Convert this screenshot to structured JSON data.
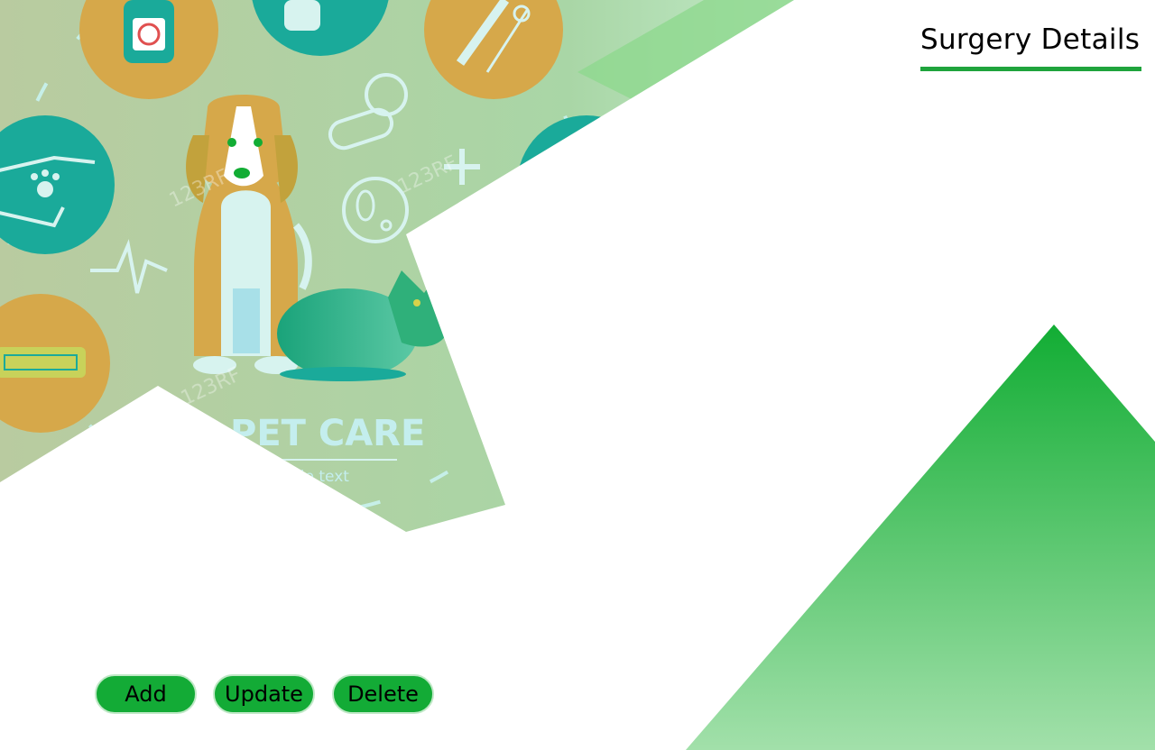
{
  "page": {
    "title": "Surgery Details"
  },
  "banner": {
    "heading": "PET CARE",
    "subtext": "ple text"
  },
  "actions": {
    "add_label": "Add",
    "update_label": "Update",
    "delete_label": "Delete"
  },
  "colors": {
    "accent": "#1fa43c",
    "button": "#13ab36",
    "circle_teal": "#1aaa9a",
    "circle_orange": "#d6a84a",
    "panel_sage": "#b9cba0"
  },
  "illustration": {
    "icons": [
      "bottle-icon",
      "vet-icon",
      "scissors-comb-icon",
      "hands-paw-icon",
      "pills-icon",
      "bacteria-icon",
      "heartbeat-icon",
      "dog-icon",
      "cat-icon",
      "paw-tag-icon"
    ]
  }
}
